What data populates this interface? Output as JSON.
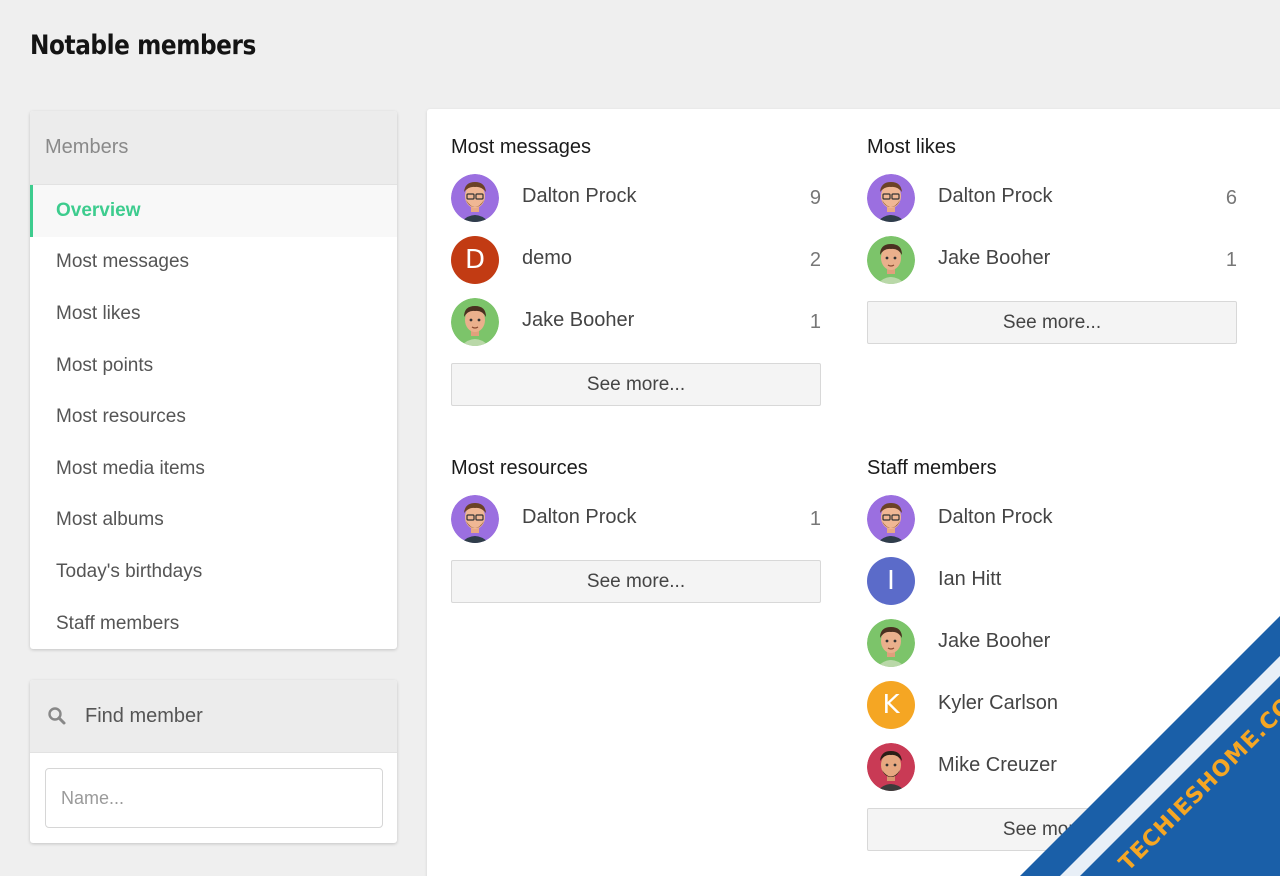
{
  "page": {
    "title": "Notable members"
  },
  "sidebar": {
    "header": "Members",
    "items": [
      {
        "label": "Overview",
        "active": true
      },
      {
        "label": "Most messages"
      },
      {
        "label": "Most likes"
      },
      {
        "label": "Most points"
      },
      {
        "label": "Most resources"
      },
      {
        "label": "Most media items"
      },
      {
        "label": "Most albums"
      },
      {
        "label": "Today's birthdays"
      },
      {
        "label": "Staff members"
      }
    ]
  },
  "find": {
    "header": "Find member",
    "icon": "search-icon",
    "placeholder": "Name..."
  },
  "sections": {
    "most_messages": {
      "title": "Most messages",
      "members": [
        {
          "name": "Dalton Prock",
          "count": "9"
        },
        {
          "name": "demo",
          "count": "2",
          "letter": "D"
        },
        {
          "name": "Jake Booher",
          "count": "1"
        }
      ],
      "see_more": "See more..."
    },
    "most_likes": {
      "title": "Most likes",
      "members": [
        {
          "name": "Dalton Prock",
          "count": "6"
        },
        {
          "name": "Jake Booher",
          "count": "1"
        }
      ],
      "see_more": "See more..."
    },
    "most_resources": {
      "title": "Most resources",
      "members": [
        {
          "name": "Dalton Prock",
          "count": "1"
        }
      ],
      "see_more": "See more..."
    },
    "staff_members": {
      "title": "Staff members",
      "members": [
        {
          "name": "Dalton Prock"
        },
        {
          "name": "Ian Hitt",
          "letter": "I"
        },
        {
          "name": "Jake Booher"
        },
        {
          "name": "Kyler Carlson",
          "letter": "K"
        },
        {
          "name": "Mike Creuzer"
        }
      ],
      "see_more": "See more..."
    }
  },
  "watermark": {
    "text": "TECHIESHOME.COM"
  },
  "colors": {
    "accent": "#3dcc8e",
    "avatar_demo": "#c23b13",
    "avatar_ian": "#5b6bc9",
    "avatar_kyler": "#f5a623",
    "watermark_bg": "#1a5fa8",
    "watermark_text": "#f5a623"
  }
}
